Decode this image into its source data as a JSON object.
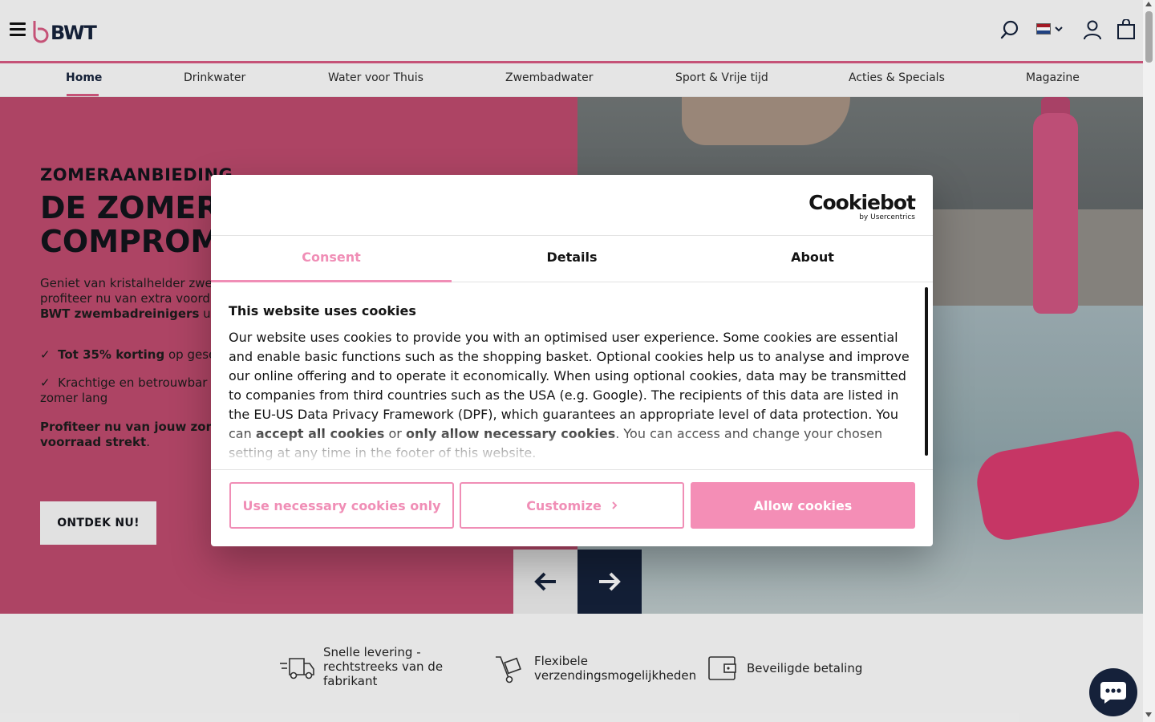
{
  "header": {
    "logo_text": "BWT",
    "icons": [
      "menu-icon",
      "search-icon",
      "flag-nl-icon",
      "chevron-down-icon",
      "account-icon",
      "cart-icon"
    ],
    "accent_color": "#d2587f"
  },
  "nav": {
    "items": [
      {
        "label": "Home",
        "active": true
      },
      {
        "label": "Drinkwater"
      },
      {
        "label": "Water voor Thuis"
      },
      {
        "label": "Zwembadwater"
      },
      {
        "label": "Sport & Vrije tijd"
      },
      {
        "label": "Acties & Specials"
      },
      {
        "label": "Magazine"
      }
    ]
  },
  "hero": {
    "eyebrow": "ZOMERAANBIEDING",
    "title": "DE ZOMER\nCOMPROM",
    "body_1": "Geniet van kristalhelder zwe",
    "body_2": "profiteer nu van extra voord",
    "body_3_bold": "BWT zwembadreinigers",
    "body_3_rest": " uit",
    "bullet_1_check": "✓",
    "bullet_1_bold": "Tot 35% korting",
    "bullet_1_rest": " op gese",
    "bullet_2_check": "✓",
    "bullet_2_line1": "Krachtige en betrouwbar",
    "bullet_2_line2": "zomer lang",
    "footer_line1": "Profiteer nu van jouw zom",
    "footer_line2": "voorraad strekt",
    "footer_period": ".",
    "cta_label": "ONTDEK NU!",
    "background_color": "#b8496b"
  },
  "usps": [
    {
      "icon": "delivery-truck-icon",
      "text": "Snelle levering - rechtstreeks van de fabrikant"
    },
    {
      "icon": "hand-truck-icon",
      "text": "Flexibele verzendingsmogelijkheden"
    },
    {
      "icon": "wallet-icon",
      "text": "Beveiligde betaling"
    }
  ],
  "cookie_dialog": {
    "brand": "Cookiebot",
    "brand_sub": "by Usercentrics",
    "tabs": [
      {
        "label": "Consent",
        "active": true
      },
      {
        "label": "Details"
      },
      {
        "label": "About"
      }
    ],
    "heading": "This website uses cookies",
    "text_part1": "Our website uses cookies to provide you with an optimised user experience. Some cookies are essential and enable basic functions such as the shopping basket. Optional cookies help us to analyse and improve our online offering and to operate it economically. When using optional cookies, data may be transmitted to companies from third countries such as the USA (e.g. Google). The recipients of this data are listed in the EU-US Data Privacy Framework (DPF), which guarantees an appropriate level of data protection. You can ",
    "text_bold1": "accept all cookies",
    "text_part2": " or ",
    "text_bold2": "only allow necessary cookies",
    "text_part3": ". You can access and change your chosen setting at any time in the footer of this website.",
    "buttons": {
      "necessary": "Use necessary cookies only",
      "customize": "Customize",
      "allow": "Allow cookies"
    },
    "accent_color": "#f08eb6"
  },
  "chat": {
    "icon": "chat-bubble-icon"
  }
}
